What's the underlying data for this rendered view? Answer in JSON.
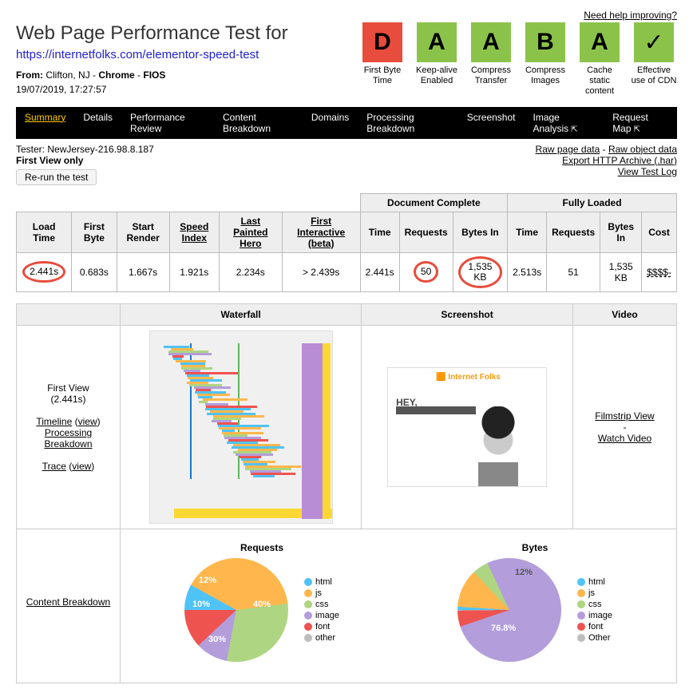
{
  "top_link": "Need help improving?",
  "title": "Web Page Performance Test for",
  "url": "https://internetfolks.com/elementor-speed-test",
  "from_label": "From:",
  "from_location": "Clifton, NJ",
  "from_browser": "Chrome",
  "from_conn": "FIOS",
  "timestamp": "19/07/2019, 17:27:57",
  "grades": [
    {
      "letter": "D",
      "cls": "grade-d",
      "label": "First Byte Time"
    },
    {
      "letter": "A",
      "cls": "grade-a",
      "label": "Keep-alive Enabled"
    },
    {
      "letter": "A",
      "cls": "grade-a",
      "label": "Compress Transfer"
    },
    {
      "letter": "B",
      "cls": "grade-b",
      "label": "Compress Images"
    },
    {
      "letter": "A",
      "cls": "grade-a",
      "label": "Cache static content"
    },
    {
      "letter": "✓",
      "cls": "grade-check",
      "label": "Effective use of CDN"
    }
  ],
  "nav": [
    "Summary",
    "Details",
    "Performance Review",
    "Content Breakdown",
    "Domains",
    "Processing Breakdown",
    "Screenshot",
    "Image Analysis",
    "Request Map"
  ],
  "tester_label": "Tester:",
  "tester_value": "NewJersey-216.98.8.187",
  "first_view_only": "First View only",
  "rerun": "Re-run the test",
  "right_links": {
    "raw_page": "Raw page data",
    "raw_object": "Raw object data",
    "export": "Export HTTP Archive (.har)",
    "view_log": "View Test Log"
  },
  "metrics_headers": {
    "doc_complete": "Document Complete",
    "fully_loaded": "Fully Loaded",
    "cols": [
      "Load Time",
      "First Byte",
      "Start Render",
      "Speed Index",
      "Last Painted Hero",
      "First Interactive (beta)",
      "Time",
      "Requests",
      "Bytes In",
      "Time",
      "Requests",
      "Bytes In",
      "Cost"
    ]
  },
  "metrics_row": {
    "load_time": "2.441s",
    "first_byte": "0.683s",
    "start_render": "1.667s",
    "speed_index": "1.921s",
    "last_painted": "2.234s",
    "first_interactive": "> 2.439s",
    "dc_time": "2.441s",
    "dc_requests": "50",
    "dc_bytes": "1,535 KB",
    "fl_time": "2.513s",
    "fl_requests": "51",
    "fl_bytes": "1,535 KB",
    "cost": "$$$$-"
  },
  "preview": {
    "headers": [
      "Waterfall",
      "Screenshot",
      "Video"
    ],
    "first_view": "First View",
    "first_view_time": "(2.441s)",
    "timeline": "Timeline",
    "view": "view",
    "processing": "Processing Breakdown",
    "trace": "Trace",
    "filmstrip": "Filmstrip View",
    "watch_video": "Watch Video"
  },
  "content_breakdown_label": "Content Breakdown",
  "ss_logo": "🟧 Internet Folks",
  "ss_hey": "HEY,",
  "chart_data": [
    {
      "type": "pie",
      "title": "Requests",
      "series": [
        {
          "name": "html",
          "value": 8,
          "color": "#4fc3f7"
        },
        {
          "name": "js",
          "value": 40,
          "color": "#ffb74d"
        },
        {
          "name": "css",
          "value": 30,
          "color": "#aed581"
        },
        {
          "name": "image",
          "value": 10,
          "color": "#b39ddb"
        },
        {
          "name": "font",
          "value": 12,
          "color": "#ef5350"
        },
        {
          "name": "other",
          "value": 0,
          "color": "#bdbdbd"
        }
      ],
      "labels": [
        "12%",
        "10%",
        "30%",
        "40%"
      ]
    },
    {
      "type": "pie",
      "title": "Bytes",
      "series": [
        {
          "name": "html",
          "value": 1,
          "color": "#4fc3f7"
        },
        {
          "name": "js",
          "value": 12,
          "color": "#ffb74d"
        },
        {
          "name": "css",
          "value": 5,
          "color": "#aed581"
        },
        {
          "name": "image",
          "value": 76.8,
          "color": "#b39ddb"
        },
        {
          "name": "font",
          "value": 5,
          "color": "#ef5350"
        },
        {
          "name": "Other",
          "value": 0.2,
          "color": "#bdbdbd"
        }
      ],
      "labels": [
        "12%",
        "76.8%"
      ]
    }
  ]
}
